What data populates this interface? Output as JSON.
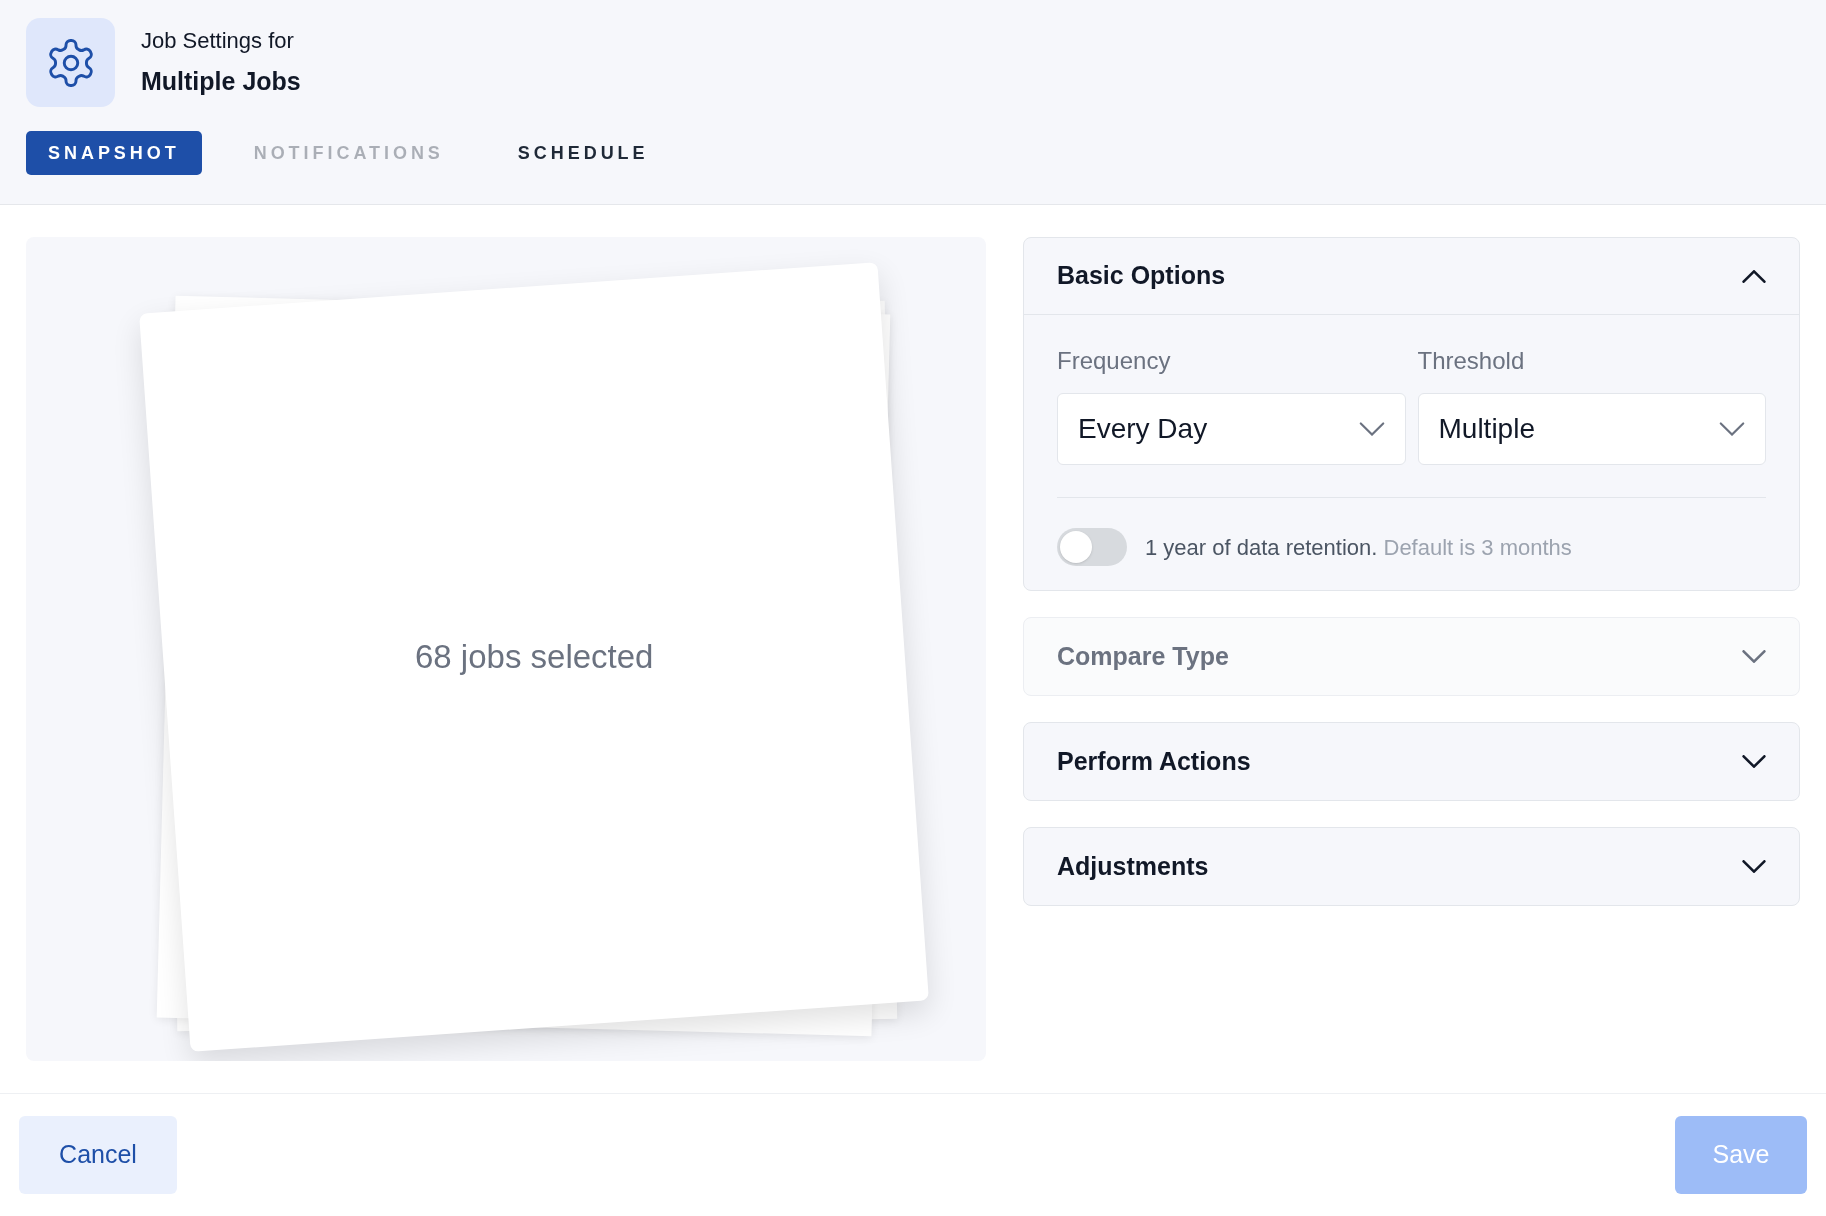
{
  "header": {
    "subtitle": "Job Settings for",
    "title": "Multiple Jobs"
  },
  "tabs": [
    {
      "label": "SNAPSHOT",
      "selected": true,
      "disabled": false
    },
    {
      "label": "NOTIFICATIONS",
      "selected": false,
      "disabled": true
    },
    {
      "label": "SCHEDULE",
      "selected": false,
      "disabled": false
    }
  ],
  "preview": {
    "caption": "68 jobs selected"
  },
  "sections": [
    {
      "title": "Basic Options",
      "expanded": true,
      "disabled": false,
      "fields": [
        {
          "label": "Frequency",
          "value": "Every Day"
        },
        {
          "label": "Threshold",
          "value": "Multiple"
        }
      ],
      "toggle": {
        "on": false,
        "label": "1 year of data retention.",
        "hint": "Default is 3 months"
      }
    },
    {
      "title": "Compare Type",
      "expanded": false,
      "disabled": true
    },
    {
      "title": "Perform Actions",
      "expanded": false,
      "disabled": false
    },
    {
      "title": "Adjustments",
      "expanded": false,
      "disabled": false
    }
  ],
  "footer": {
    "cancel": {
      "label": "Cancel",
      "disabled": false
    },
    "save": {
      "label": "Save",
      "disabled": true
    }
  }
}
